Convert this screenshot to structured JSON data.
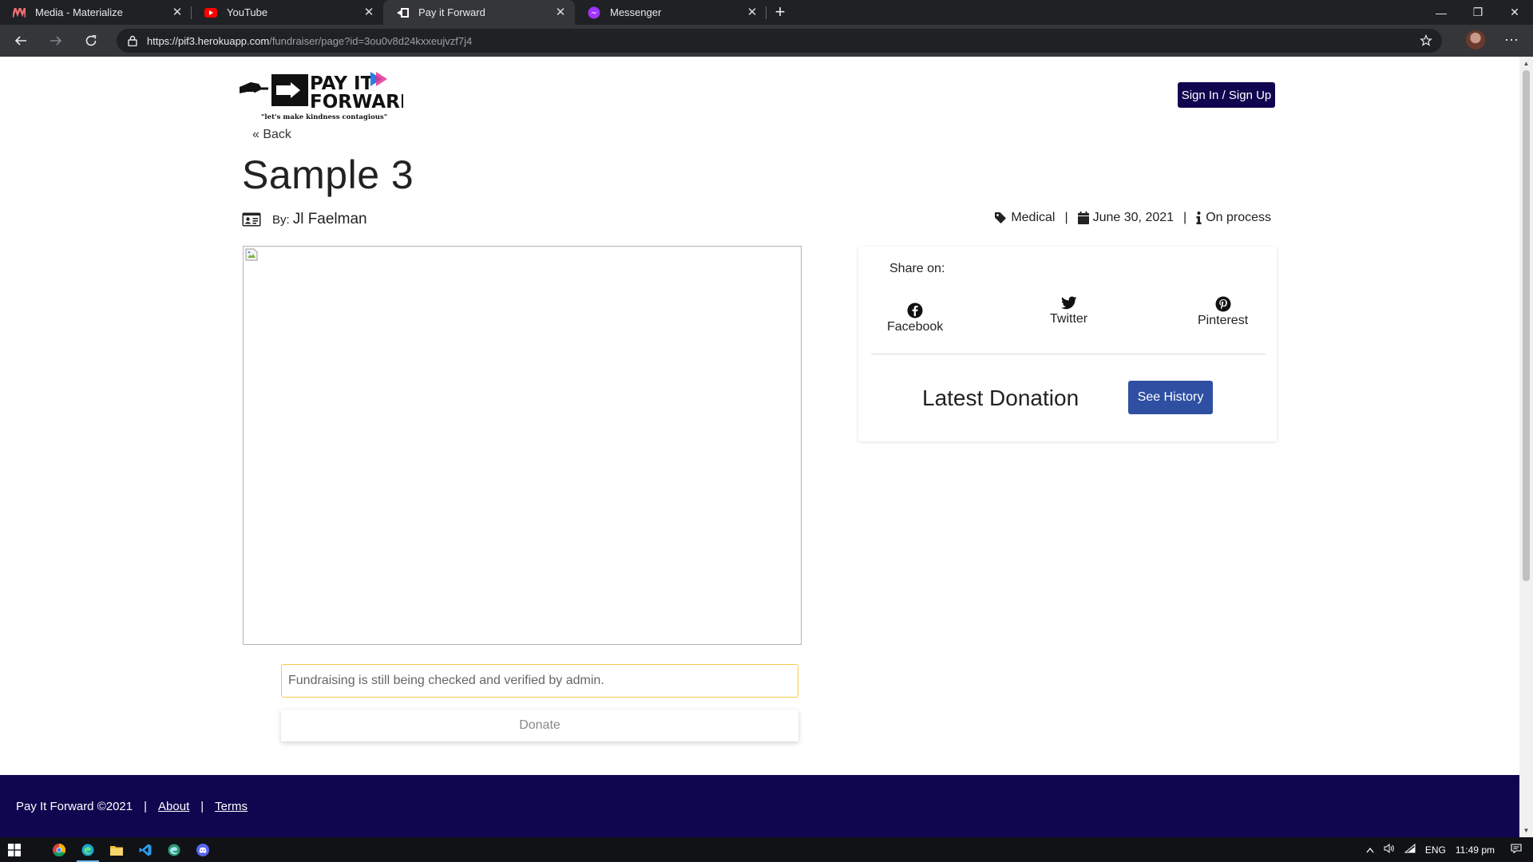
{
  "browser": {
    "tabs": [
      {
        "title": "Media - Materialize",
        "favicon": "materialize-icon",
        "color": "#ee6e73",
        "active": false
      },
      {
        "title": "YouTube",
        "favicon": "youtube-icon",
        "color": "#ff0000",
        "active": false
      },
      {
        "title": "Pay it Forward",
        "favicon": "payitforward-icon",
        "color": "#ffffff",
        "active": true
      },
      {
        "title": "Messenger",
        "favicon": "messenger-icon",
        "color": "#a033ff",
        "active": false
      }
    ],
    "url_host": "https://pif3.herokuapp.com",
    "url_path": "/fundraiser/page?id=3ou0v8d24kxxeujvzf7j4"
  },
  "page": {
    "back_label": "« Back",
    "signin_label": "Sign In / Sign Up",
    "title": "Sample 3",
    "by_label": "By:",
    "author": "Jl Faelman",
    "category": "Medical",
    "date": "June 30, 2021",
    "status": "On process",
    "verify_message": "Fundraising is still being checked and verified by admin.",
    "donate_label": "Donate",
    "logo": {
      "line1": "PAY IT",
      "line2": "FORWARD",
      "tagline": "\"let's make kindness contagious\""
    }
  },
  "share": {
    "label": "Share on:",
    "options": [
      {
        "name": "Facebook",
        "icon": "facebook-icon"
      },
      {
        "name": "Twitter",
        "icon": "twitter-icon"
      },
      {
        "name": "Pinterest",
        "icon": "pinterest-icon"
      }
    ],
    "latest_label": "Latest Donation",
    "history_label": "See History"
  },
  "footer": {
    "copyright": "Pay It Forward ©2021",
    "about": "About",
    "terms": "Terms"
  },
  "taskbar": {
    "lang": "ENG",
    "time": "11:49 pm"
  },
  "colors": {
    "brand_navy": "#10064f",
    "history_blue": "#2f4fa2",
    "verify_border": "#f2c94c"
  }
}
